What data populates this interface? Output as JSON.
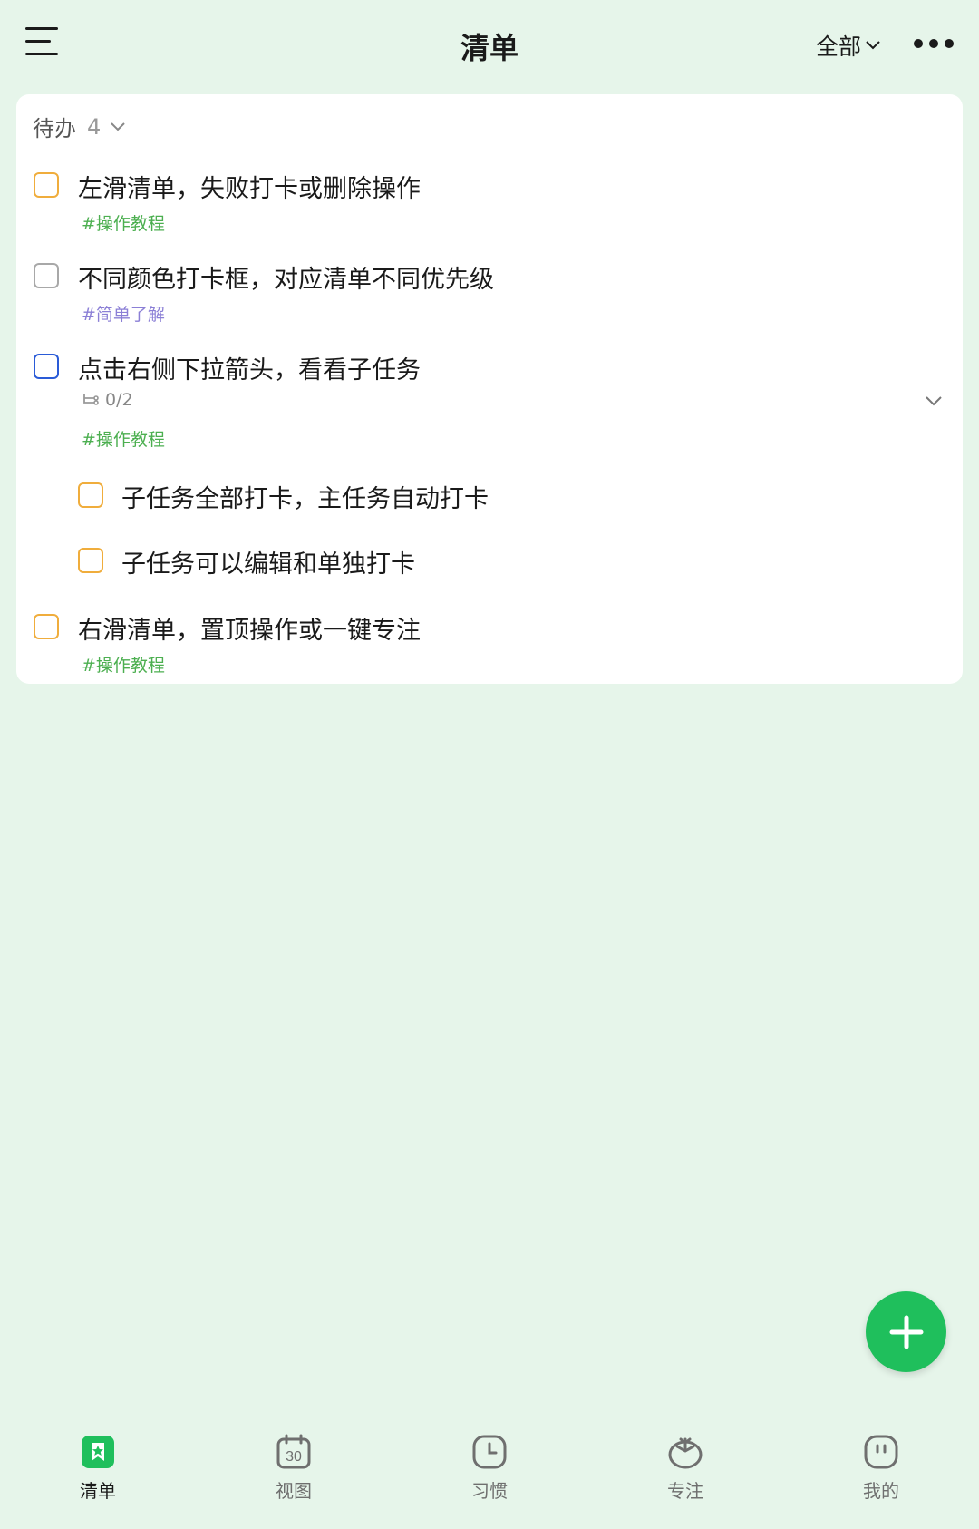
{
  "header": {
    "title": "清单",
    "filter_label": "全部",
    "menu_icon": "hamburger-menu-icon",
    "more_icon": "more-dots-icon"
  },
  "section": {
    "label": "待办",
    "count": "4"
  },
  "tasks": [
    {
      "title": "左滑清单，失败打卡或删除操作",
      "tag": "#操作教程",
      "checkbox_color": "#f0ad3c"
    },
    {
      "title": "不同颜色打卡框，对应清单不同优先级",
      "tag": "#简单了解",
      "checkbox_color": "#a8a8a8"
    },
    {
      "title": "点击右侧下拉箭头，看看子任务",
      "subtask_count": "0/2",
      "tag": "#操作教程",
      "checkbox_color": "#2a5bd7",
      "subtasks": [
        {
          "title": "子任务全部打卡，主任务自动打卡",
          "checkbox_color": "#f0ad3c"
        },
        {
          "title": "子任务可以编辑和单独打卡",
          "checkbox_color": "#f0ad3c"
        }
      ]
    },
    {
      "title": "右滑清单，置顶操作或一键专注",
      "tag": "#操作教程",
      "checkbox_color": "#f0ad3c"
    }
  ],
  "fab": {
    "icon": "plus-icon",
    "color": "#1fbf5c"
  },
  "bottom_nav": [
    {
      "label": "清单",
      "icon": "checklist-icon",
      "active": true
    },
    {
      "label": "视图",
      "icon": "calendar-icon",
      "icon_text": "30"
    },
    {
      "label": "习惯",
      "icon": "clock-icon"
    },
    {
      "label": "专注",
      "icon": "tomato-icon"
    },
    {
      "label": "我的",
      "icon": "profile-face-icon"
    }
  ],
  "colors": {
    "background": "#e6f5ea",
    "accent": "#1fbf5c",
    "tag_green": "#4caf50",
    "tag_purple": "#8b7fd6"
  }
}
